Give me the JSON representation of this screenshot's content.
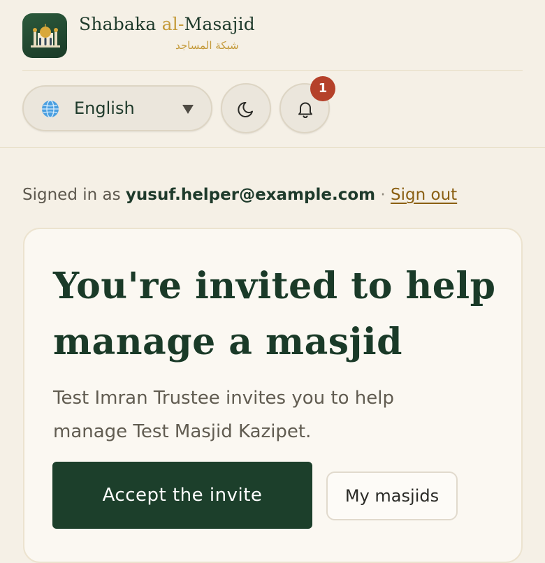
{
  "brand": {
    "name_part1": "Shabaka ",
    "name_accent": "al-",
    "name_part2": "Masajid",
    "name_arabic": "شبكة المساجد",
    "accent_color": "#c49a3a",
    "primary_color": "#1c3f2b"
  },
  "toolbar": {
    "language_selected": "English",
    "theme_icon": "moon-icon",
    "notifications_icon": "bell-icon",
    "notification_count": "1"
  },
  "session": {
    "signed_in_label": "Signed in as ",
    "email": "yusuf.helper@example.com",
    "separator": " · ",
    "sign_out": "Sign out"
  },
  "invite": {
    "title": "You're invited to help manage a masjid",
    "body": "Test Imran Trustee invites you to help manage Test Masjid Kazipet.",
    "accept_label": "Accept the invite",
    "my_masjids_label": "My masjids"
  }
}
